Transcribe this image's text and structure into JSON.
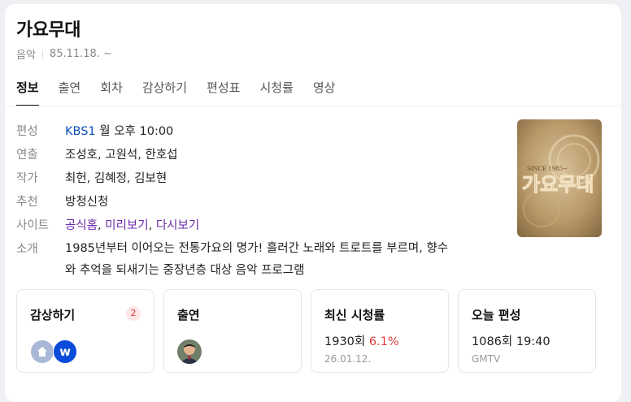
{
  "program": {
    "title": "가요무대",
    "genre": "음악",
    "start_date": "85.11.18. ~"
  },
  "tabs": [
    {
      "label": "정보",
      "active": true
    },
    {
      "label": "출연"
    },
    {
      "label": "회차"
    },
    {
      "label": "감상하기"
    },
    {
      "label": "편성표"
    },
    {
      "label": "시청률"
    },
    {
      "label": "영상"
    }
  ],
  "info": {
    "broadcast_label": "편성",
    "channel": "KBS1",
    "schedule": "월 오후 10:00",
    "director_label": "연출",
    "directors": "조성호, 고원석, 한호섭",
    "writer_label": "작가",
    "writers": "최헌, 김혜정, 김보현",
    "recommend_label": "추천",
    "recommend_link": "방청신청",
    "site_label": "사이트",
    "site_links": [
      "공식홈",
      "미리보기",
      "다시보기"
    ],
    "intro_label": "소개",
    "intro_line1": "1985년부터 이어오는 전통가요의 명가! 흘러간 노래와 트로트를 부르며, 향수",
    "intro_line2": "와 추억을 되새기는 중장년층 대상 음악 프로그램"
  },
  "poster": {
    "since": "SINCE 1985~",
    "logo_text": "가요무대"
  },
  "cards": {
    "watch": {
      "title": "감상하기",
      "count": "2",
      "icons": [
        "home-icon",
        "wavve-icon"
      ],
      "wavve_letter": "w"
    },
    "cast": {
      "title": "출연"
    },
    "rating": {
      "title": "최신 시청률",
      "episode": "1930회",
      "rate": "6.1%",
      "date": "26.01.12."
    },
    "today": {
      "title": "오늘 편성",
      "episode_time": "1086회 19:40",
      "channel": "GMTV"
    }
  },
  "colors": {
    "link_blue": "#0b4fbd",
    "link_purple": "#6a2aa8",
    "accent_red": "#e03c3c"
  }
}
